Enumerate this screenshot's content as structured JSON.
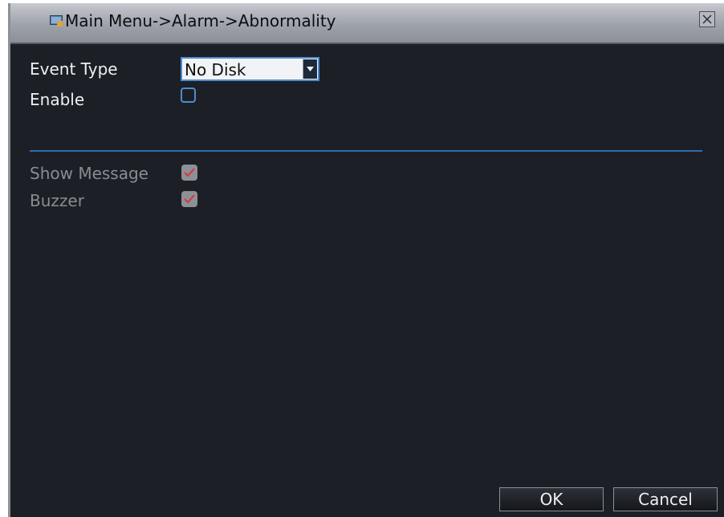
{
  "window": {
    "title": "Main Menu->Alarm->Abnormality",
    "title_icon": "monitor-icon",
    "close_icon": "close-icon",
    "colors": {
      "background": "#1d1f27",
      "accent": "#4d8bd0",
      "divider": "#2f6ca8",
      "check_mark": "#d9363b"
    }
  },
  "form": {
    "event_type_label": "Event Type",
    "event_type_value": "No Disk",
    "enable_label": "Enable",
    "enable_checked": false,
    "show_message_label": "Show Message",
    "show_message_checked": true,
    "buzzer_label": "Buzzer",
    "buzzer_checked": true
  },
  "buttons": {
    "ok": "OK",
    "cancel": "Cancel"
  }
}
